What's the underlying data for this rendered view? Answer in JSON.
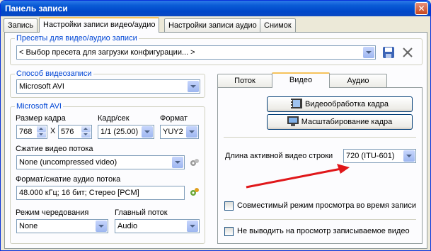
{
  "window": {
    "title": "Панель записи",
    "close_symbol": "✕"
  },
  "tabs": [
    {
      "label": "Запись"
    },
    {
      "label": "Настройки записи видео/аудио",
      "active": true
    },
    {
      "label": "Настройки записи аудио"
    },
    {
      "label": "Снимок"
    }
  ],
  "presets": {
    "title": "Пресеты для видео/аудио записи",
    "value": "< Выбор пресета для загрузки конфигурации... >"
  },
  "capture_method": {
    "title": "Способ видеозаписи",
    "value": "Microsoft AVI"
  },
  "avi": {
    "title": "Microsoft AVI",
    "frame_size_label": "Размер кадра",
    "width": "768",
    "times": "X",
    "height": "576",
    "fps_label": "Кадр/сек",
    "fps_value": "1/1 (25.00)",
    "format_label": "Формат",
    "format_value": "YUY2",
    "video_compress_label": "Сжатие видео потока",
    "video_compress_value": "None (uncompressed video)",
    "audio_format_label": "Формат/сжатие аудио потока",
    "audio_format_value": "48.000 кГц; 16 бит; Стерео [PCM]",
    "interleave_label": "Режим чередования",
    "interleave_value": "None",
    "master_label": "Главный поток",
    "master_value": "Audio"
  },
  "right_tabs": [
    {
      "label": "Поток"
    },
    {
      "label": "Видео",
      "active": true
    },
    {
      "label": "Аудио"
    }
  ],
  "video": {
    "frame_processing_button": "Видеообработка кадра",
    "frame_scaling_button": "Масштабирование кадра",
    "active_line_label": "Длина активной видео строки",
    "active_line_value": "720 (ITU-601)",
    "compat_preview_label": "Совместимый режим просмотра во время записи",
    "no_preview_label": "Не выводить на просмотр записываемое видео"
  },
  "colors": {
    "accent": "#0046d5",
    "titlebar": "#0047c9",
    "arrow": "#e0171a"
  }
}
